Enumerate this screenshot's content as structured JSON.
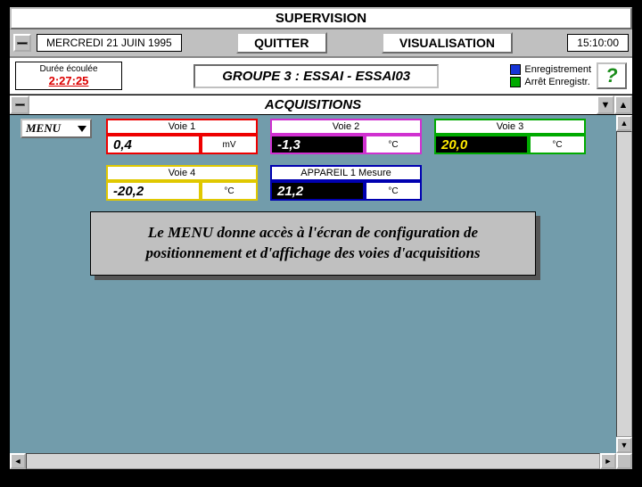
{
  "title": "SUPERVISION",
  "date": "MERCREDI 21 JUIN 1995",
  "quit": "QUITTER",
  "visual": "VISUALISATION",
  "time": "15:10:00",
  "duree": {
    "label": "Durée écoulée",
    "value": "2:27:25"
  },
  "group": "GROUPE 3 : ESSAI - ESSAI03",
  "legend": {
    "rec": "Enregistrement",
    "stop": "Arrêt Enregistr."
  },
  "help": "?",
  "acq_title": "ACQUISITIONS",
  "menu_btn": "MENU",
  "channels": {
    "v1": {
      "name": "Voie 1",
      "value": "0,4",
      "unit": "mV"
    },
    "v2": {
      "name": "Voie 2",
      "value": "-1,3",
      "unit": "°C"
    },
    "v3": {
      "name": "Voie 3",
      "value": "20,0",
      "unit": "°C"
    },
    "v4": {
      "name": "Voie 4",
      "value": "-20,2",
      "unit": "°C"
    },
    "v5": {
      "name": "APPAREIL 1 Mesure",
      "value": "21,2",
      "unit": "°C"
    }
  },
  "note": "Le MENU donne accès à l'écran de configuration de positionnement et d'affichage des voies d'acquisitions",
  "arrows": {
    "up": "▲",
    "down": "▼",
    "left": "◄",
    "right": "►",
    "min": "▼",
    "max": "▲"
  }
}
